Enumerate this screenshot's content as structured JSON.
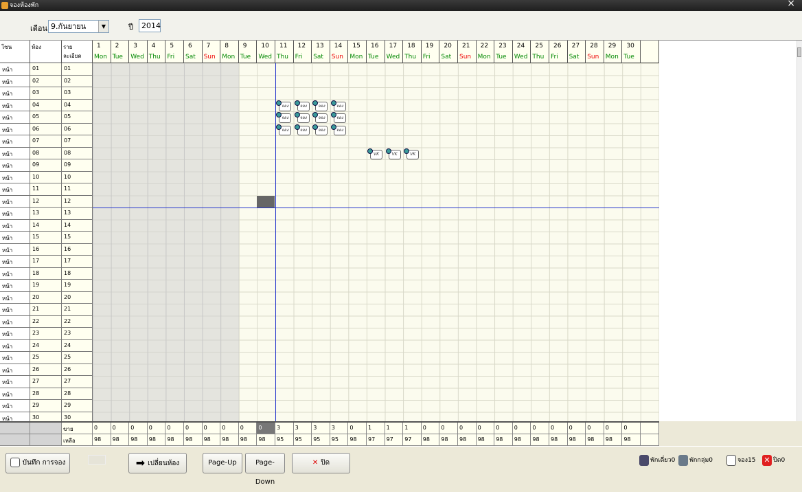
{
  "window": {
    "title": "จองห้องพัก",
    "close_glyph": "×"
  },
  "toolbar": {
    "month_label": "เดือน",
    "month_value": "9.กันยายน",
    "year_label": "ปี",
    "year_value": "2014"
  },
  "table": {
    "headers": [
      "โซน",
      "ห้อง",
      "รายละเอียด"
    ],
    "days": [
      {
        "n": "1",
        "w": "Mon"
      },
      {
        "n": "2",
        "w": "Tue"
      },
      {
        "n": "3",
        "w": "Wed"
      },
      {
        "n": "4",
        "w": "Thu"
      },
      {
        "n": "5",
        "w": "Fri"
      },
      {
        "n": "6",
        "w": "Sat"
      },
      {
        "n": "7",
        "w": "Sun"
      },
      {
        "n": "8",
        "w": "Mon"
      },
      {
        "n": "9",
        "w": "Tue"
      },
      {
        "n": "10",
        "w": "Wed"
      },
      {
        "n": "11",
        "w": "Thu"
      },
      {
        "n": "12",
        "w": "Fri"
      },
      {
        "n": "13",
        "w": "Sat"
      },
      {
        "n": "14",
        "w": "Sun"
      },
      {
        "n": "15",
        "w": "Mon"
      },
      {
        "n": "16",
        "w": "Tue"
      },
      {
        "n": "17",
        "w": "Wed"
      },
      {
        "n": "18",
        "w": "Thu"
      },
      {
        "n": "19",
        "w": "Fri"
      },
      {
        "n": "20",
        "w": "Sat"
      },
      {
        "n": "21",
        "w": "Sun"
      },
      {
        "n": "22",
        "w": "Mon"
      },
      {
        "n": "23",
        "w": "Tue"
      },
      {
        "n": "24",
        "w": "Wed"
      },
      {
        "n": "25",
        "w": "Thu"
      },
      {
        "n": "26",
        "w": "Fri"
      },
      {
        "n": "27",
        "w": "Sat"
      },
      {
        "n": "28",
        "w": "Sun"
      },
      {
        "n": "29",
        "w": "Mon"
      },
      {
        "n": "30",
        "w": "Tue"
      }
    ],
    "zone": "หน้า",
    "rooms": [
      "01",
      "02",
      "03",
      "04",
      "05",
      "06",
      "07",
      "08",
      "09",
      "10",
      "11",
      "12",
      "13",
      "14",
      "15",
      "16",
      "17",
      "18",
      "19",
      "20",
      "21",
      "22",
      "23",
      "24",
      "25",
      "26",
      "27",
      "28",
      "29",
      "30"
    ],
    "bookings": [
      {
        "room": "04",
        "days": [
          11,
          12,
          13,
          14
        ],
        "icon": "booking-icon",
        "text": "จอง"
      },
      {
        "room": "05",
        "days": [
          11,
          12,
          13,
          14
        ],
        "icon": "booking-icon",
        "text": "จอง"
      },
      {
        "room": "06",
        "days": [
          11,
          12,
          13,
          14
        ],
        "icon": "booking-icon",
        "text": "จอง"
      },
      {
        "room": "08",
        "days": [
          16,
          17,
          18
        ],
        "icon": "vk-booking-icon",
        "text": "VK"
      }
    ],
    "past_days": 8,
    "today": 11,
    "selected": {
      "room": "12",
      "day": 10
    }
  },
  "footer": {
    "sold_label": "ขาย",
    "remain_label": "เหลือ",
    "sold": [
      "0",
      "0",
      "0",
      "0",
      "0",
      "0",
      "0",
      "0",
      "0",
      "0",
      "3",
      "3",
      "3",
      "3",
      "0",
      "1",
      "1",
      "1",
      "0",
      "0",
      "0",
      "0",
      "0",
      "0",
      "0",
      "0",
      "0",
      "0",
      "0",
      "0"
    ],
    "remain": [
      "98",
      "98",
      "98",
      "98",
      "98",
      "98",
      "98",
      "98",
      "98",
      "98",
      "95",
      "95",
      "95",
      "95",
      "98",
      "97",
      "97",
      "97",
      "98",
      "98",
      "98",
      "98",
      "98",
      "98",
      "98",
      "98",
      "98",
      "98",
      "98",
      "98"
    ]
  },
  "buttons": {
    "save": "บันทึก การจอง",
    "change_room": "เปลี่ยนห้อง",
    "page_up": "Page-Up",
    "page_down": "Page-Down",
    "close": "ปิด"
  },
  "status": {
    "single": "พักเดี่ยว0",
    "group": "พักกลุ่ม0",
    "booking": "จอง15",
    "closed": "ปิด0"
  },
  "colors": {
    "weekday": "#008800",
    "sunday": "#e00000",
    "gridline": "#2233cc",
    "selected": "#666666"
  }
}
